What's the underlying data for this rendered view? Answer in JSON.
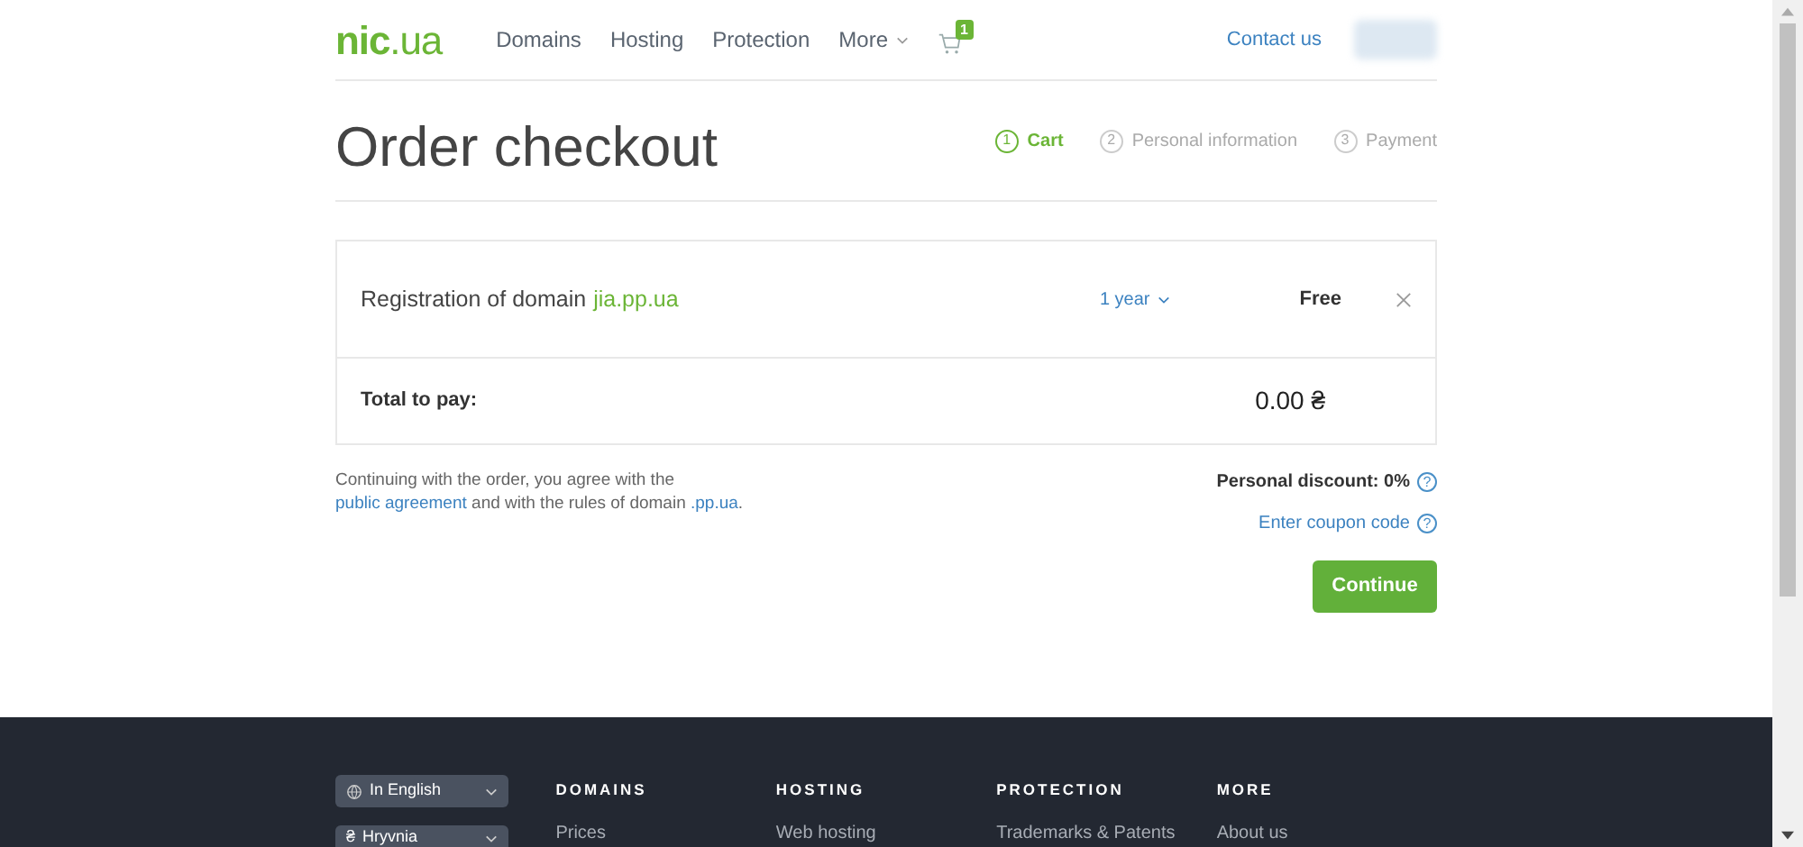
{
  "header": {
    "logo": "**nic**.ua",
    "nav": [
      {
        "label": "Domains",
        "dropdown": false
      },
      {
        "label": "Hosting",
        "dropdown": false
      },
      {
        "label": "Protection",
        "dropdown": false
      },
      {
        "label": "More",
        "dropdown": true
      }
    ],
    "cart_count": "1",
    "contact": "Contact us"
  },
  "title": "Order checkout",
  "steps": [
    {
      "number": "1",
      "label": "Cart",
      "selected": true
    },
    {
      "number": "2",
      "label": "Personal information",
      "selected": false
    },
    {
      "number": "3",
      "label": "Payment",
      "selected": false
    }
  ],
  "order": {
    "item_label": "Registration of domain",
    "domain": "jia.pp.ua",
    "period": "1 year",
    "price": "Free",
    "total_label": "Total to pay:",
    "total": "0.00 ₴"
  },
  "agreement": {
    "before": "Continuing with the order, you agree with the",
    "link1": "public agreement",
    "middle": "and with the rules of domain",
    "link2": ".pp.ua",
    "after": "."
  },
  "help_symbol": "?",
  "discount": "Personal discount: 0%",
  "coupon": "Enter coupon code",
  "continue": "Continue",
  "footer": {
    "language": "In English",
    "currency_symbol": "₴",
    "currency": "Hryvnia",
    "columns": [
      {
        "heading": "DOMAINS",
        "link": "Prices"
      },
      {
        "heading": "HOSTING",
        "link": "Web hosting"
      },
      {
        "heading": "PROTECTION",
        "link": "Trademarks & Patents"
      },
      {
        "heading": "MORE",
        "link": "About us"
      }
    ]
  }
}
